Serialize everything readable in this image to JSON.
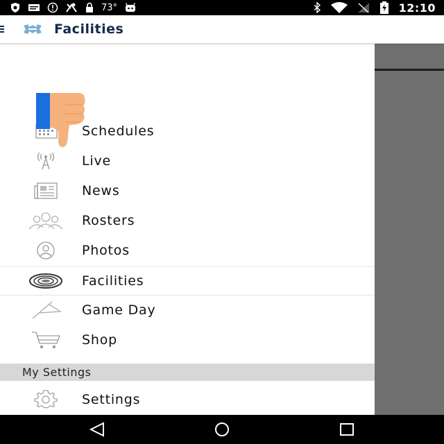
{
  "status_bar": {
    "temperature": "73°",
    "time": "12:10",
    "icons": [
      "shield-icon",
      "message-icon",
      "alert-icon",
      "sports-icon",
      "lock-icon",
      "android-icon",
      "bluetooth-icon",
      "wifi-icon",
      "signal-icon",
      "battery-icon"
    ]
  },
  "app_bar": {
    "title": "Facilities",
    "menu_icon": "hamburger-icon",
    "logo": "unc-logo"
  },
  "drawer": {
    "items": [
      {
        "label": "Schedules",
        "icon": "calendar-icon"
      },
      {
        "label": "Live",
        "icon": "antenna-icon"
      },
      {
        "label": "News",
        "icon": "newspaper-icon"
      },
      {
        "label": "Rosters",
        "icon": "people-icon"
      },
      {
        "label": "Photos",
        "icon": "person-circle-icon"
      },
      {
        "label": "Facilities",
        "icon": "stadium-icon",
        "selected": true
      },
      {
        "label": "Game Day",
        "icon": "pennant-icon"
      },
      {
        "label": "Shop",
        "icon": "cart-icon"
      }
    ],
    "section_header": "My Settings",
    "settings_item": {
      "label": "Settings",
      "icon": "gear-icon"
    }
  },
  "overlay": {
    "icon": "thumbs-down-icon"
  },
  "nav_bar": {
    "buttons": [
      "back-icon",
      "home-icon",
      "recents-icon"
    ]
  },
  "colors": {
    "title": "#142a4a",
    "accent": "#7bafd4",
    "status_bar": "#000000",
    "section_header": "#d7d7d7",
    "scrim": "#6f6f6f",
    "thumb": "#f5b27c",
    "thumb_cuff": "#1a6fe0"
  }
}
